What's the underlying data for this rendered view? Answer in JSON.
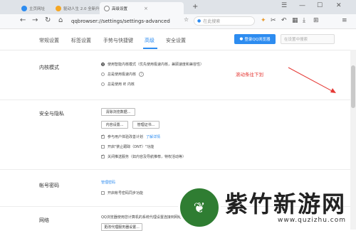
{
  "tabs": [
    {
      "label": "主页网址",
      "fav_color": "#2d8cf0"
    },
    {
      "label": "驱动人生 2.0 全新升级",
      "fav_color": "#f5a623"
    },
    {
      "label": "高级设置",
      "fav_color": "#e0e0e0",
      "close": "×"
    }
  ],
  "new_tab": "+",
  "window_controls": {
    "minimize": "—",
    "maximize": "☐",
    "close": "✕"
  },
  "address": {
    "url": "qqbrowser://settings/settings-advanced",
    "star": "☆",
    "search_placeholder": "在此搜索"
  },
  "settings_nav": {
    "items": [
      "常规设置",
      "标签设置",
      "手势与快捷键",
      "高级",
      "安全设置"
    ],
    "active_index": 3,
    "login_button": "登录QQ浏览器",
    "search_placeholder": "在设置中搜索"
  },
  "kernel": {
    "title": "内核模式",
    "options": [
      {
        "label": "使用智能内核模式（优先使用极速内核，兼顾速度和兼容性）",
        "checked": true
      },
      {
        "label": "总是使用极速内核",
        "checked": false,
        "help": "?"
      },
      {
        "label": "总是使用 IE 内核",
        "checked": false
      }
    ]
  },
  "annotation": "滚动条往下划",
  "security": {
    "title": "安全与隐私",
    "clear_button": "清除浏览数据...",
    "content_button": "内容设置...",
    "cert_button": "管理证书...",
    "checks": [
      {
        "label": "参与用户体验改善计划",
        "link": "了解详情",
        "checked": true
      },
      {
        "label": "开启\"禁止跟踪（DNT）\"功能",
        "checked": false
      },
      {
        "label": "关闭推送服务（如内容及导航推荐，特权活动等）",
        "checked": true
      }
    ]
  },
  "account": {
    "title": "帐号密码",
    "manage_link": "管理密码",
    "sync_label": "开启帐号密码同步功能",
    "sync_checked": false
  },
  "network": {
    "title": "网络",
    "desc": "QQ浏览器使用您计算机的系统代理设置连接到网络。",
    "proxy_button": "更改代理服务器设置..."
  },
  "watermark": {
    "title": "紫竹新游网",
    "url": "www.quzizhu.com"
  }
}
